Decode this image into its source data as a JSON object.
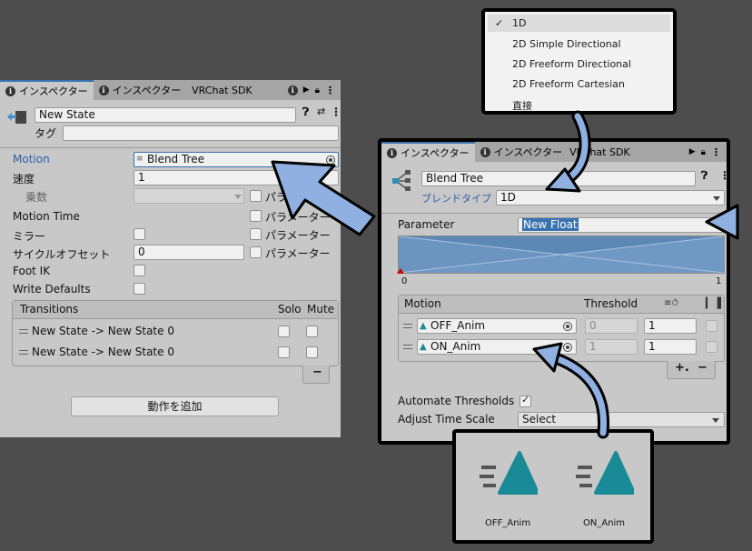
{
  "left_inspector": {
    "tabs": [
      "インスペクター",
      "インスペクター",
      "VRChat SDK"
    ],
    "state_name": "New State",
    "tag_label": "タグ",
    "tag_value": "",
    "rows": {
      "motion_label": "Motion",
      "motion_value": "Blend Tree",
      "speed_label": "速度",
      "speed_value": "1",
      "multiplier_label": "乗数",
      "motion_time_label": "Motion Time",
      "mirror_label": "ミラー",
      "cycle_offset_label": "サイクルオフセット",
      "cycle_offset_value": "0",
      "foot_ik_label": "Foot IK",
      "write_defaults_label": "Write Defaults",
      "parameter_label": "パラメーター"
    },
    "transitions": {
      "header": "Transitions",
      "solo": "Solo",
      "mute": "Mute",
      "items": [
        "New State -> New State 0",
        "New State -> New State 0"
      ],
      "minus": "−"
    },
    "add_behaviour_button": "動作を追加"
  },
  "dropdown_menu": {
    "check": "✓",
    "items": [
      "1D",
      "2D Simple Directional",
      "2D Freeform Directional",
      "2D Freeform Cartesian",
      "直接"
    ]
  },
  "right_inspector": {
    "tabs": [
      "インスペクター",
      "インスペクター",
      "VRChat SDK"
    ],
    "tree_name": "Blend Tree",
    "blend_type_label": "ブレンドタイプ",
    "blend_type_value": "1D",
    "parameter_label": "Parameter",
    "parameter_value": "New Float",
    "graph_min": "0",
    "graph_max": "1",
    "motion_header": "Motion",
    "threshold_header": "Threshold",
    "motions": [
      {
        "name": "OFF_Anim",
        "threshold": "0",
        "time_scale": "1"
      },
      {
        "name": "ON_Anim",
        "threshold": "1",
        "time_scale": "1"
      }
    ],
    "plus": "+.",
    "minus": "−",
    "automate_thresholds_label": "Automate Thresholds",
    "adjust_time_scale_label": "Adjust Time Scale",
    "adjust_time_scale_value": "Select"
  },
  "anim_assets": {
    "items": [
      "OFF_Anim",
      "ON_Anim"
    ],
    "icon_color": "#1a8a96"
  },
  "colors": {
    "arrow_fill": "#8fb0e0",
    "highlight_blue": "#3a72b0"
  }
}
